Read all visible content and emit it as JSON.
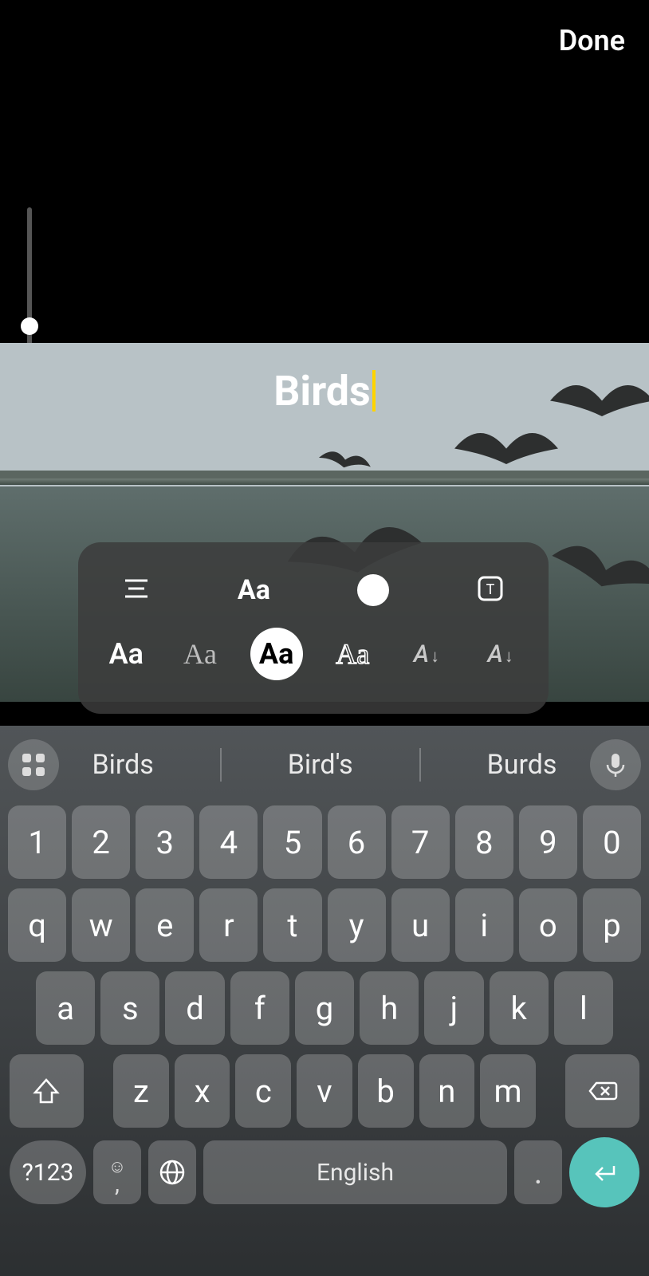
{
  "header": {
    "done_label": "Done"
  },
  "overlay": {
    "text": "Birds"
  },
  "text_panel": {
    "font_size_label": "Aa",
    "fonts": [
      "Aa",
      "Aa",
      "Aa",
      "Aa",
      "A",
      "A"
    ]
  },
  "suggestions": {
    "items": [
      "Birds",
      "Bird's",
      "Burds"
    ]
  },
  "keyboard": {
    "row_num": [
      "1",
      "2",
      "3",
      "4",
      "5",
      "6",
      "7",
      "8",
      "9",
      "0"
    ],
    "row_top": [
      "q",
      "w",
      "e",
      "r",
      "t",
      "y",
      "u",
      "i",
      "o",
      "p"
    ],
    "row_mid": [
      "a",
      "s",
      "d",
      "f",
      "g",
      "h",
      "j",
      "k",
      "l"
    ],
    "row_bot": [
      "z",
      "x",
      "c",
      "v",
      "b",
      "n",
      "m"
    ],
    "sym_label": "?123",
    "comma_label": ",",
    "emoji_label": "☺",
    "period_label": ".",
    "space_label": "English"
  }
}
